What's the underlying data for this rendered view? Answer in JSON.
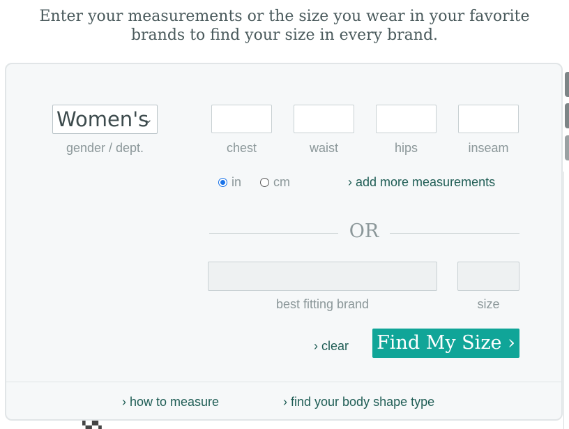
{
  "intro": {
    "line1": "Enter your measurements or the size you wear in your favorite",
    "line2": "brands to find your size in every brand."
  },
  "gender": {
    "selected": "Women's",
    "label": "gender / dept."
  },
  "measurements": {
    "fields": [
      {
        "label": "chest",
        "value": ""
      },
      {
        "label": "waist",
        "value": ""
      },
      {
        "label": "hips",
        "value": ""
      },
      {
        "label": "inseam",
        "value": ""
      }
    ]
  },
  "units": {
    "options": [
      "in",
      "cm"
    ],
    "selected": "in",
    "add_more_link": "› add more measurements"
  },
  "or_text": "OR",
  "brand": {
    "brand_label": "best fitting brand",
    "brand_value": "",
    "size_label": "size",
    "size_value": ""
  },
  "actions": {
    "clear_link": "› clear",
    "find_button": "Find My Size ›"
  },
  "footer": {
    "how_to_measure": "› how to measure",
    "body_shape": "› find your body shape type"
  },
  "colors": {
    "accent": "#10a598",
    "link": "#1f5d55",
    "label": "#8b9799",
    "panel_bg": "#f6f8f9"
  }
}
